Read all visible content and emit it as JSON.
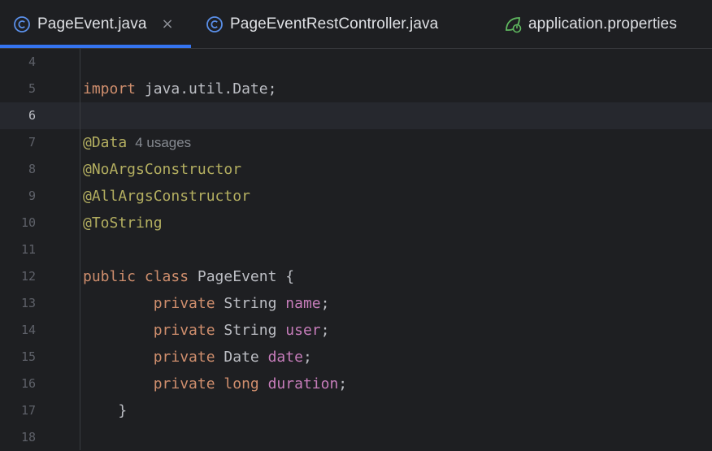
{
  "tabs": [
    {
      "label": "PageEvent.java",
      "active": true,
      "icon": "java-class-icon",
      "closable": true
    },
    {
      "label": "PageEventRestController.java",
      "active": false,
      "icon": "java-class-icon"
    },
    {
      "label": "application.properties",
      "active": false,
      "icon": "spring-properties-icon"
    }
  ],
  "close_glyph": "×",
  "editor": {
    "current_line": "6",
    "lines": [
      {
        "n": "4"
      },
      {
        "n": "5",
        "kw": "import",
        "rest": " java.util.Date;"
      },
      {
        "n": "6"
      },
      {
        "n": "7",
        "ann": "@Data",
        "hint": "4 usages"
      },
      {
        "n": "8",
        "ann": "@NoArgsConstructor"
      },
      {
        "n": "9",
        "ann": "@AllArgsConstructor"
      },
      {
        "n": "10",
        "ann": "@ToString"
      },
      {
        "n": "11"
      },
      {
        "n": "12",
        "kw": "public class",
        "rest": " PageEvent {"
      },
      {
        "n": "13",
        "indent": "        ",
        "kw": "private",
        "type": " String ",
        "field": "name",
        "end": ";"
      },
      {
        "n": "14",
        "indent": "        ",
        "kw": "private",
        "type": " String ",
        "field": "user",
        "end": ";"
      },
      {
        "n": "15",
        "indent": "        ",
        "kw": "private",
        "type": " Date ",
        "field": "date",
        "end": ";"
      },
      {
        "n": "16",
        "indent": "        ",
        "kw": "private long",
        "type": " ",
        "field": "duration",
        "end": ";"
      },
      {
        "n": "17",
        "rest": "    }"
      },
      {
        "n": "18"
      }
    ]
  },
  "colors": {
    "keyword": "#cf8e6d",
    "annotation": "#b3ae60",
    "field": "#c77dbb",
    "text": "#bcbec4",
    "accent": "#3574f0"
  }
}
